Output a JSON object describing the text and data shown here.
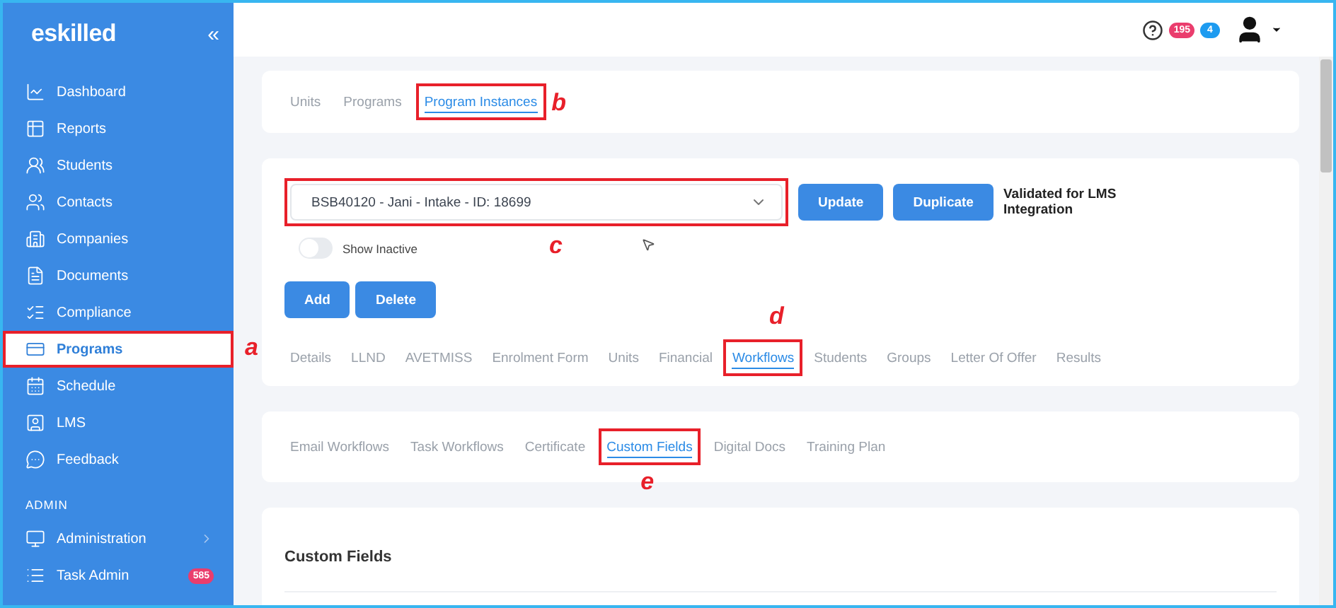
{
  "sidebar": {
    "logo": "eskilled",
    "collapse": "«",
    "items": [
      {
        "label": "Dashboard",
        "selected": false
      },
      {
        "label": "Reports",
        "selected": false
      },
      {
        "label": "Students",
        "selected": false
      },
      {
        "label": "Contacts",
        "selected": false
      },
      {
        "label": "Companies",
        "selected": false
      },
      {
        "label": "Documents",
        "selected": false
      },
      {
        "label": "Compliance",
        "selected": false
      },
      {
        "label": "Programs",
        "selected": true,
        "callout": "a"
      },
      {
        "label": "Schedule",
        "selected": false
      },
      {
        "label": "LMS",
        "selected": false
      },
      {
        "label": "Feedback",
        "selected": false
      }
    ],
    "section": "ADMIN",
    "admin_items": [
      {
        "label": "Administration",
        "expandable": true
      },
      {
        "label": "Task Admin",
        "expandable": false,
        "badge": "585"
      }
    ]
  },
  "topbar": {
    "badges": [
      {
        "count": "195",
        "color": "#ea3d6d"
      },
      {
        "count": "4",
        "color": "#1d9bf0"
      }
    ]
  },
  "program_tabs": [
    {
      "label": "Units",
      "selected": false
    },
    {
      "label": "Programs",
      "selected": false
    },
    {
      "label": "Program Instances",
      "selected": true,
      "callout": "b"
    }
  ],
  "instance": {
    "select_value": "BSB40120 - Jani - Intake - ID: 18699",
    "select_callout": "c",
    "buttons": [
      "Update",
      "Duplicate"
    ],
    "validated": "Validated for LMS Integration",
    "show_inactive": {
      "label": "Show Inactive",
      "on": false
    },
    "actions": [
      "Add",
      "Delete"
    ]
  },
  "detail_tabs": [
    {
      "label": "Details",
      "selected": false
    },
    {
      "label": "LLND",
      "selected": false
    },
    {
      "label": "AVETMISS",
      "selected": false
    },
    {
      "label": "Enrolment Form",
      "selected": false
    },
    {
      "label": "Units",
      "selected": false
    },
    {
      "label": "Financial",
      "selected": false
    },
    {
      "label": "Workflows",
      "selected": true,
      "callout": "d"
    },
    {
      "label": "Students",
      "selected": false
    },
    {
      "label": "Groups",
      "selected": false
    },
    {
      "label": "Letter Of Offer",
      "selected": false
    },
    {
      "label": "Results",
      "selected": false
    }
  ],
  "workflow_tabs": [
    {
      "label": "Email Workflows",
      "selected": false
    },
    {
      "label": "Task Workflows",
      "selected": false
    },
    {
      "label": "Certificate",
      "selected": false
    },
    {
      "label": "Custom Fields",
      "selected": true,
      "callout": "e"
    },
    {
      "label": "Digital Docs",
      "selected": false
    },
    {
      "label": "Training Plan",
      "selected": false
    }
  ],
  "panel": {
    "title": "Custom Fields"
  }
}
